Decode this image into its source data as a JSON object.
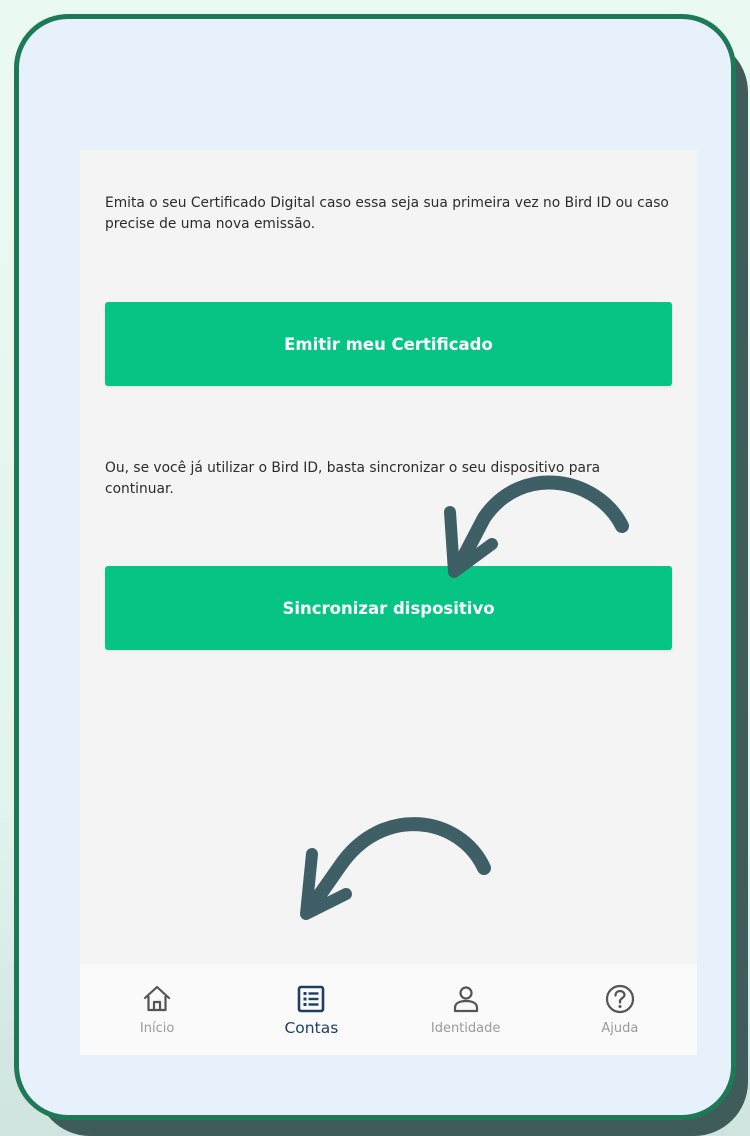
{
  "content": {
    "intro_text": "Emita o seu Certificado Digital caso essa seja sua primeira vez no Bird ID ou caso precise de uma nova emissão.",
    "emit_button_label": "Emitir meu Certificado",
    "sync_text": "Ou, se você já utilizar o Bird ID, basta sincronizar o seu dispositivo para continuar.",
    "sync_button_label": "Sincronizar dispositivo"
  },
  "bottom_nav": {
    "items": [
      {
        "label": "Início",
        "icon": "home-icon",
        "active": false
      },
      {
        "label": "Contas",
        "icon": "list-icon",
        "active": true
      },
      {
        "label": "Identidade",
        "icon": "user-icon",
        "active": false
      },
      {
        "label": "Ajuda",
        "icon": "help-icon",
        "active": false
      }
    ]
  },
  "colors": {
    "primary_button": "#06c584",
    "card_border": "#1e7a56",
    "active_nav": "#1e3f63",
    "arrow": "#3e5f65"
  }
}
